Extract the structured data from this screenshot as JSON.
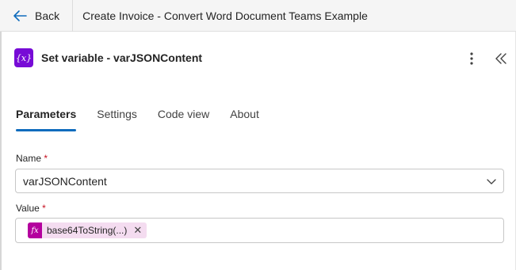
{
  "topbar": {
    "back_label": "Back",
    "flow_title": "Create Invoice - Convert Word Document Teams Example"
  },
  "action": {
    "icon_text": "{x}",
    "title": "Set variable - varJSONContent"
  },
  "tabs": [
    {
      "label": "Parameters",
      "active": true
    },
    {
      "label": "Settings",
      "active": false
    },
    {
      "label": "Code view",
      "active": false
    },
    {
      "label": "About",
      "active": false
    }
  ],
  "fields": {
    "name": {
      "label": "Name",
      "required_mark": "*",
      "value": "varJSONContent"
    },
    "value": {
      "label": "Value",
      "required_mark": "*",
      "token": {
        "icon": "fx",
        "text": "base64ToString(...)",
        "remove_glyph": "✕"
      }
    }
  },
  "colors": {
    "accent": "#0f6cbd",
    "action_icon_bg": "#770bd6",
    "token_icon_bg": "#b4009e",
    "token_bg": "#f4dcf0",
    "required": "#c50f1f"
  }
}
